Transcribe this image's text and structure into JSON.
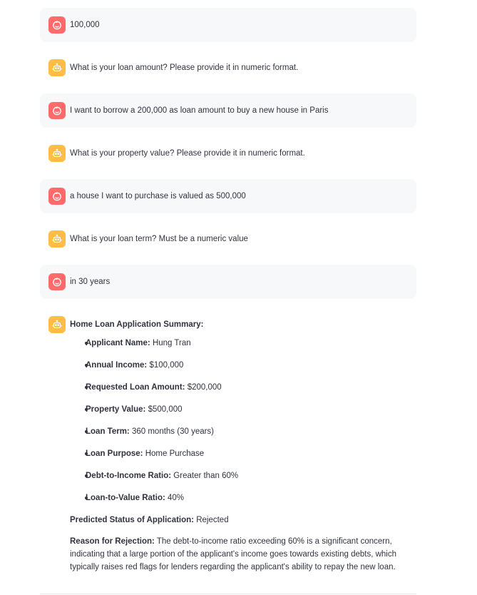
{
  "messages": [
    {
      "role": "user",
      "text": "100,000"
    },
    {
      "role": "assistant",
      "text": "What is your loan amount? Please provide it in numeric format."
    },
    {
      "role": "user",
      "text": "I want to borrow a 200,000 as loan amount to buy a new house in Paris"
    },
    {
      "role": "assistant",
      "text": "What is your property value? Please provide it in numeric format."
    },
    {
      "role": "user",
      "text": "a house I want to purchase is valued as 500,000"
    },
    {
      "role": "assistant",
      "text": "What is your loan term? Must be a numeric value"
    },
    {
      "role": "user",
      "text": "in 30 years"
    }
  ],
  "summary": {
    "title": "Home Loan Application Summary:",
    "items": [
      {
        "label": "Applicant Name:",
        "value": " Hung Tran"
      },
      {
        "label": "Annual Income:",
        "value": " $100,000"
      },
      {
        "label": "Requested Loan Amount:",
        "value": " $200,000"
      },
      {
        "label": "Property Value:",
        "value": " $500,000"
      },
      {
        "label": "Loan Term:",
        "value": " 360 months (30 years)"
      },
      {
        "label": "Loan Purpose:",
        "value": " Home Purchase"
      },
      {
        "label": "Debt-to-Income Ratio:",
        "value": " Greater than 60%"
      },
      {
        "label": "Loan-to-Value Ratio:",
        "value": " 40%"
      }
    ],
    "status_label": "Predicted Status of Application:",
    "status_value": " Rejected",
    "reason_label": "Reason for Rejection:",
    "reason_value": " The debt-to-income ratio exceeding 60% is a significant concern, indicating that a large portion of the applicant's income goes towards existing debts, which typically raises red flags for lenders regarding the applicant's ability to repay the new loan."
  },
  "colors": {
    "user_avatar": "#ff6b6b",
    "assistant_avatar": "#ffbd45",
    "user_bubble": "#f7f8fa",
    "text": "#31333f"
  },
  "icons": {
    "user": "smiling-face-icon",
    "assistant": "robot-face-icon"
  }
}
